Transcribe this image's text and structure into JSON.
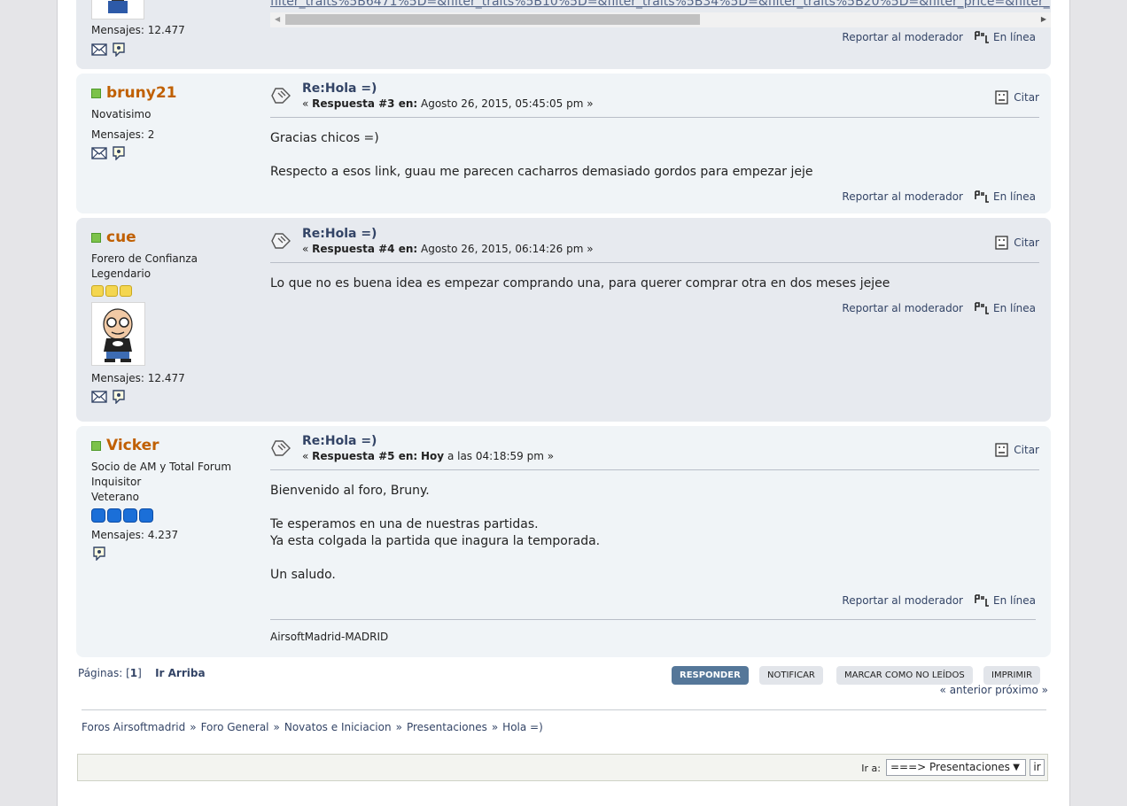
{
  "top_post": {
    "link_text": "filter_traits%5B6471%5D=&filter_traits%5B10%5D=&filter_traits%5B34%5D=&filter_traits%5B20%5D=&filter_price=&filter_",
    "posts_label": "Mensajes: 12.477",
    "report_label": "Reportar al moderador",
    "online_label": "En línea"
  },
  "posts": [
    {
      "username": "bruny21",
      "titles": [
        "Novatisimo"
      ],
      "stars": 0,
      "posts_label": "Mensajes: 2",
      "subject": "Re:Hola =)",
      "meta_prefix": "«",
      "meta_reply": "Respuesta #3 en:",
      "meta_date": "Agosto 26, 2015, 05:45:05 pm",
      "meta_suffix": "»",
      "quote_label": "Citar",
      "content": [
        "Gracias chicos =)",
        "",
        "Respecto a esos link, guau me parecen cacharros demasiado gordos para empezar jeje"
      ],
      "report_label": "Reportar al moderador",
      "online_label": "En línea"
    },
    {
      "username": "cue",
      "titles": [
        "Forero de Confianza",
        "Legendario"
      ],
      "stars": 3,
      "posts_label": "Mensajes: 12.477",
      "subject": "Re:Hola =)",
      "meta_prefix": "«",
      "meta_reply": "Respuesta #4 en:",
      "meta_date": "Agosto 26, 2015, 06:14:26 pm",
      "meta_suffix": "»",
      "quote_label": "Citar",
      "content": [
        "Lo que no es buena idea es empezar comprando una, para querer comprar otra en dos meses jejee"
      ],
      "report_label": "Reportar al moderador",
      "online_label": "En línea"
    },
    {
      "username": "Vicker",
      "titles": [
        "Socio de AM y Total Forum",
        "Inquisitor",
        "Veterano"
      ],
      "stars": 4,
      "posts_label": "Mensajes: 4.237",
      "subject": "Re:Hola =)",
      "meta_prefix": "«",
      "meta_reply": "Respuesta #5 en:",
      "meta_today": "Hoy",
      "meta_date": "a las 04:18:59 pm",
      "meta_suffix": "»",
      "quote_label": "Citar",
      "content": [
        "Bienvenido al foro, Bruny.",
        "",
        "Te esperamos en una de nuestras partidas.",
        "Ya esta colgada la partida que inagura la temporada.",
        "",
        "Un saludo."
      ],
      "report_label": "Reportar al moderador",
      "online_label": "En línea",
      "signature": "AirsoftMadrid-MADRID"
    }
  ],
  "pagination": {
    "label": "Páginas: [",
    "current": "1",
    "close": "]",
    "go_up": "Ir Arriba"
  },
  "buttons": {
    "reply": "Responder",
    "notify": "Notificar",
    "mark_unread": "Marcar como no leídos",
    "print": "Imprimir"
  },
  "prev_next": "« anterior próximo »",
  "breadcrumb": [
    "Foros Airsoftmadrid",
    "Foro General",
    "Novatos e Iniciacion",
    "Presentaciones",
    "Hola =)"
  ],
  "breadcrumb_sep": "»",
  "jump": {
    "label": "Ir a:",
    "selected": "===> Presentaciones",
    "go": "ir"
  },
  "colors": {
    "username": "#c06002",
    "link": "#334466",
    "post_bg_light": "#f0f4f7",
    "post_bg_dark": "#e7eaef",
    "reply_button": "#557799"
  }
}
